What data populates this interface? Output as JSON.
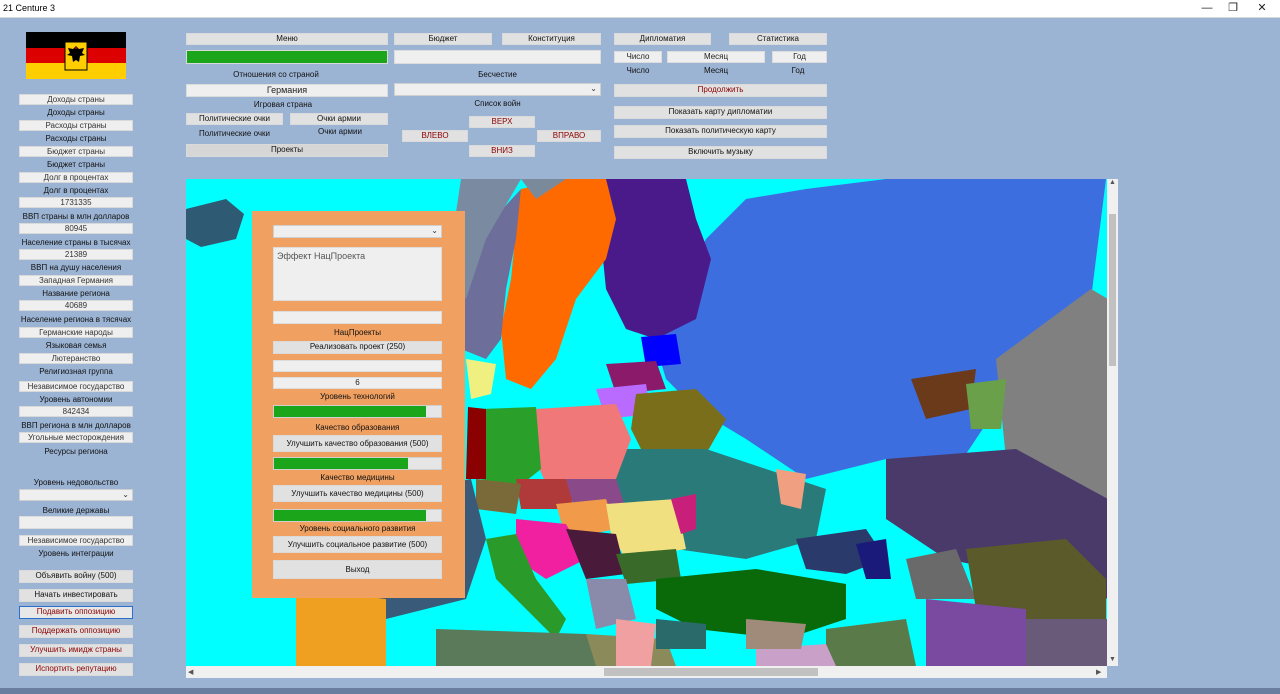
{
  "window": {
    "title": "21 Centure 3",
    "minimize": "—",
    "maximize": "❐",
    "close": "✕"
  },
  "flag": {
    "colors": [
      "#000000",
      "#dd0000",
      "#ffce00"
    ],
    "emblem": "eagle-emblem"
  },
  "top": {
    "menu": "Меню",
    "budget": "Бюджет",
    "constitution": "Конституция",
    "diplomacy": "Дипломатия",
    "statistics": "Статистика",
    "relations_label": "Отношения со страной",
    "lawlessness_label": "Бесчестие",
    "day_box": "Число",
    "month_box": "Месяц",
    "year_box": "Год",
    "day_label": "Число",
    "month_label": "Месяц",
    "year_label": "Год",
    "country_field": "Германия",
    "player_country_label": "Игровая страна",
    "war_list_label": "Список войн",
    "political_points_box": "Политические очки",
    "army_points_box": "Очки армии",
    "political_points_label": "Политические очки",
    "army_points_label": "Очки армии",
    "projects": "Проекты",
    "up": "ВЕРХ",
    "left": "ВЛЕВО",
    "right": "ВПРАВО",
    "down": "ВНИЗ",
    "continue": "Продолжить",
    "show_diplomacy_map": "Показать карту дипломатии",
    "show_political_map": "Показать политическую карту",
    "music_on": "Включить музыку"
  },
  "sidebar": [
    {
      "text": "Доходы страны",
      "box": true
    },
    {
      "text": "Доходы страны",
      "box": false
    },
    {
      "text": "Расходы страны",
      "box": true
    },
    {
      "text": "Расходы страны",
      "box": false
    },
    {
      "text": "Бюджет страны",
      "box": true
    },
    {
      "text": "Бюджет страны",
      "box": false
    },
    {
      "text": "Долг в процентах",
      "box": true
    },
    {
      "text": "Долг в процентах",
      "box": false
    },
    {
      "text": "1731335",
      "box": true
    },
    {
      "text": "ВВП страны в млн долларов",
      "box": false
    },
    {
      "text": "80945",
      "box": true
    },
    {
      "text": "Население страны в тысячах",
      "box": false
    },
    {
      "text": "21389",
      "box": true
    },
    {
      "text": "ВВП на душу населения",
      "box": false
    },
    {
      "text": "Западная Германия",
      "box": true
    },
    {
      "text": "Название региона",
      "box": false
    },
    {
      "text": "40689",
      "box": true
    },
    {
      "text": "Население региона в тясячах",
      "box": false
    },
    {
      "text": "Германские народы",
      "box": true
    },
    {
      "text": "Языковая семья",
      "box": false
    },
    {
      "text": "Лютеранство",
      "box": true
    },
    {
      "text": "Религиозная группа",
      "box": false
    },
    {
      "text": "Независимое государство",
      "box": true
    },
    {
      "text": "Уровень автономии",
      "box": false
    },
    {
      "text": "842434",
      "box": true
    },
    {
      "text": "ВВП региона в млн долларов",
      "box": false
    },
    {
      "text": "Угольные месторождения",
      "box": true
    },
    {
      "text": "Ресурсы региона",
      "box": false
    }
  ],
  "sidebar_lower": {
    "resources_level_label": "Уровень недовольство",
    "great_powers_label": "Великие державы",
    "independent_state": "Независимое государство",
    "integration_level_label": "Уровень интеграции",
    "declare_war": "Объявить войну (500)",
    "start_investing": "Начать инвестировать",
    "suppress_opposition": "Подавить оппозицию",
    "support_opposition": "Поддержать оппозицию",
    "improve_image": "Улучшить имидж страны",
    "spoil_reputation": "Испортить репутацию"
  },
  "panel": {
    "effect_placeholder": "Эффект НацПроекта",
    "nat_projects_label": "НацПроекты",
    "implement_project": "Реализовать проект (250)",
    "tech_value": "6",
    "tech_label": "Уровень технологий",
    "tech_progress": 0.91,
    "education_label": "Качество образования",
    "improve_education": "Улучшить качество образования (500)",
    "medicine_progress": 0.8,
    "medicine_label": "Качество медицины",
    "improve_medicine": "Улучшить качество медицины (500)",
    "social_progress": 0.91,
    "social_label": "Уровень социального развития",
    "improve_social": "Улучшить социальное развитие (500)",
    "exit": "Выход"
  },
  "relations_progress": 1.0,
  "colors": {
    "sea": "#00ffff",
    "panel": "#f0a060",
    "progress": "#1aa51a",
    "background": "#9cb4d4"
  }
}
